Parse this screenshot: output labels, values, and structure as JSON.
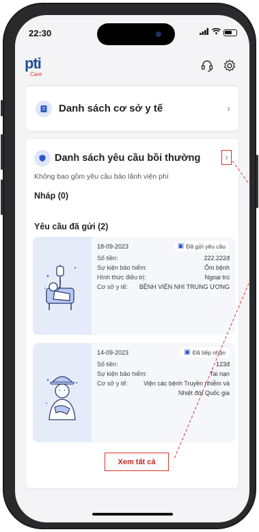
{
  "status_bar": {
    "time": "22:30",
    "signal": "signal-icon",
    "wifi": "wifi-icon",
    "battery": "battery-icon"
  },
  "header": {
    "logo_text": "pti",
    "logo_sub": "Care",
    "support_icon": "headset-icon",
    "settings_icon": "gear-icon"
  },
  "facilities_card": {
    "title": "Danh sách cơ sở y tế",
    "icon": "hospital-icon"
  },
  "claims_card": {
    "title": "Danh sách yêu cầu bồi thường",
    "note": "Không bao gồm yêu cầu bảo lãnh viện phí",
    "draft_label": "Nháp (0)",
    "sent_label": "Yêu cầu đã gửi (2)",
    "claims": [
      {
        "date": "18-09-2023",
        "status": "Đã gửi yêu cầu",
        "rows": [
          {
            "label": "Số tiền:",
            "value": "222.222đ"
          },
          {
            "label": "Sự kiện bảo hiểm:",
            "value": "Ốm bệnh"
          },
          {
            "label": "Hình thức điều trị:",
            "value": "Ngoại trú"
          },
          {
            "label": "Cơ sở y tế:",
            "value": "BỆNH VIỆN NHI TRUNG ƯƠNG"
          }
        ]
      },
      {
        "date": "14-09-2023",
        "status": "Đã tiếp nhận",
        "rows": [
          {
            "label": "Số tiền:",
            "value": "123đ"
          },
          {
            "label": "Sự kiện bảo hiểm:",
            "value": "Tai nạn"
          },
          {
            "label": "Cơ sở y tế:",
            "value": "Viện các bệnh Truyền nhiễm và Nhiệt đới Quốc gia"
          }
        ]
      }
    ],
    "view_all": "Xem tất cả"
  },
  "colors": {
    "accent": "#2c57c8",
    "highlight": "#d9322a",
    "brand": "#1d4d9c"
  }
}
